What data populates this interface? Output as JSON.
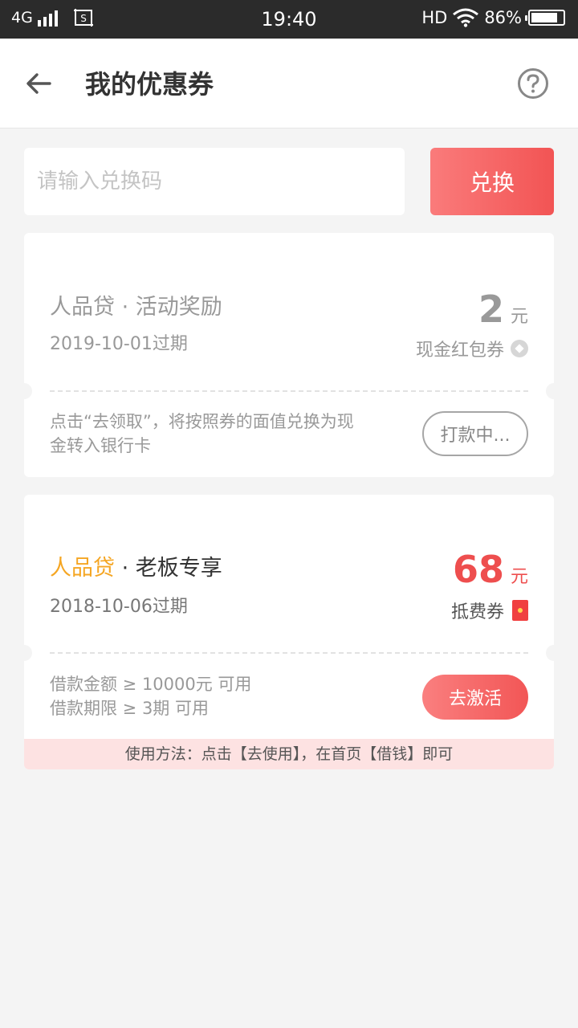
{
  "status_bar": {
    "network": "4G",
    "time": "19:40",
    "hd": "HD",
    "battery_level": 0.86,
    "battery_text": "86%"
  },
  "header": {
    "title": "我的优惠券"
  },
  "redeem": {
    "placeholder": "请输入兑换码",
    "button_label": "兑换"
  },
  "coupons": [
    {
      "brand": "人品贷",
      "separator": " · ",
      "name": "活动奖励",
      "expiry": "2019-10-01过期",
      "amount": "2",
      "unit": "元",
      "type": "现金红包券",
      "description": "点击“去领取”，将按照券的面值兑换为现金转入银行卡",
      "action_label": "打款中..."
    },
    {
      "brand": "人品贷",
      "separator": " · ",
      "name": "老板专享",
      "expiry": "2018-10-06过期",
      "amount": "68",
      "unit": "元",
      "type": "抵费券",
      "condition_1": "借款金额 ≥ 10000元 可用",
      "condition_2": "借款期限 ≥ 3期 可用",
      "action_label": "去激活",
      "usage": "使用方法：点击【去使用】，在首页【借钱】即可"
    }
  ],
  "colors": {
    "accent": "#f25454",
    "brand_gold": "#f5a623",
    "amount_red": "#ee4e4e"
  }
}
